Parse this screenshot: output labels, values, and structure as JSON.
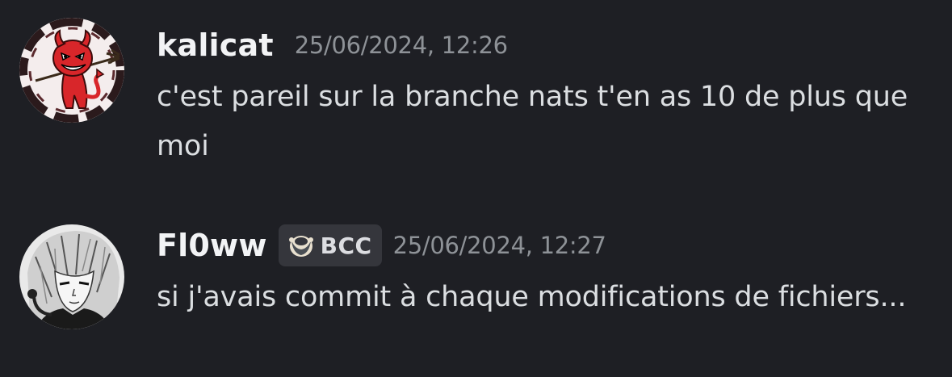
{
  "messages": [
    {
      "username": "kalicat",
      "timestamp": "25/06/2024, 12:26",
      "text": "c'est pareil sur la branche nats t'en as 10 de plus que moi",
      "avatar_icon": "devil-avatar-icon"
    },
    {
      "username": "Fl0ww",
      "tag": {
        "label": "BCC",
        "icon": "guild-tag-icon"
      },
      "timestamp": "25/06/2024, 12:27",
      "text": "si j'avais commit à chaque modifications de fichiers...",
      "avatar_icon": "anime-character-avatar-icon"
    }
  ],
  "colors": {
    "background": "#1e1f24",
    "username": "#f2f3f5",
    "timestamp": "#8e9297",
    "message_text": "#dbdee1",
    "tag_background": "#35363c"
  }
}
